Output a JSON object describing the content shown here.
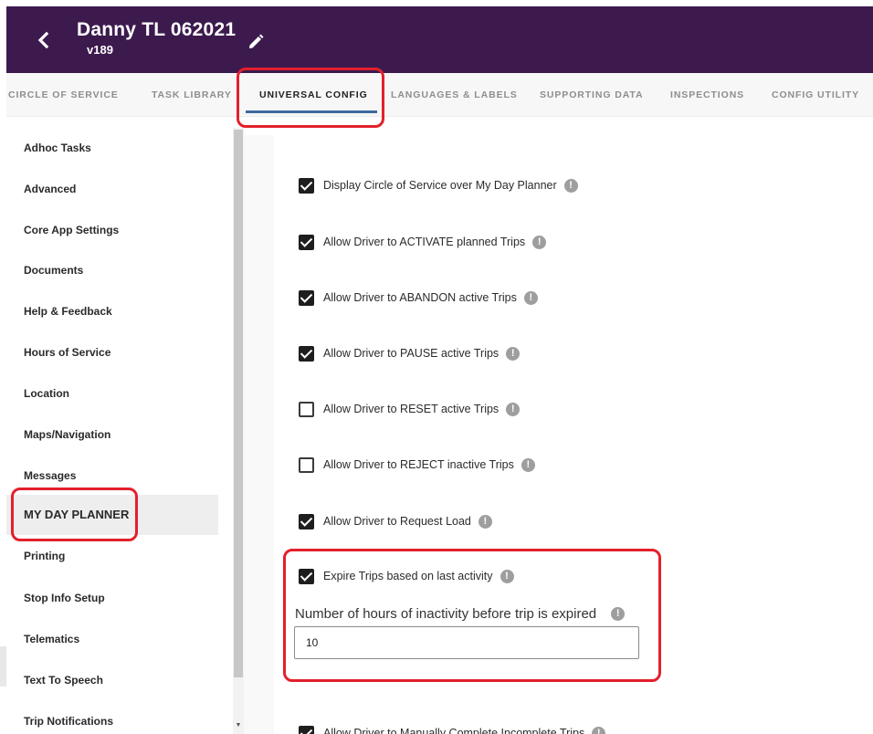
{
  "header": {
    "title": "Danny TL 062021",
    "version": "v189",
    "back_icon": "chevron-left-icon",
    "edit_icon": "pencil-icon",
    "background": "#3c1a4e"
  },
  "tabs": [
    {
      "label": "CIRCLE OF SERVICE"
    },
    {
      "label": "TASK LIBRARY"
    },
    {
      "label": "UNIVERSAL CONFIG",
      "active": true
    },
    {
      "label": "LANGUAGES & LABELS"
    },
    {
      "label": "SUPPORTING DATA"
    },
    {
      "label": "INSPECTIONS"
    },
    {
      "label": "CONFIG UTILITY"
    }
  ],
  "sidebar": {
    "items": [
      {
        "label": "Adhoc Tasks"
      },
      {
        "label": "Advanced"
      },
      {
        "label": "Core App Settings"
      },
      {
        "label": "Documents"
      },
      {
        "label": "Help & Feedback"
      },
      {
        "label": "Hours of Service"
      },
      {
        "label": "Location"
      },
      {
        "label": "Maps/Navigation"
      },
      {
        "label": "Messages"
      },
      {
        "label": "MY DAY PLANNER",
        "active": true
      },
      {
        "label": "Printing"
      },
      {
        "label": "Stop Info Setup"
      },
      {
        "label": "Telematics"
      },
      {
        "label": "Text To Speech"
      },
      {
        "label": "Trip Notifications"
      }
    ]
  },
  "options": [
    {
      "label": "Display Circle of Service over My Day Planner",
      "checked": true
    },
    {
      "label": "Allow Driver to ACTIVATE planned Trips",
      "checked": true
    },
    {
      "label": "Allow Driver to ABANDON active Trips",
      "checked": true
    },
    {
      "label": "Allow Driver to PAUSE active Trips",
      "checked": true
    },
    {
      "label": "Allow Driver to RESET active Trips",
      "checked": false
    },
    {
      "label": "Allow Driver to REJECT inactive Trips",
      "checked": false
    },
    {
      "label": "Allow Driver to Request Load",
      "checked": true
    },
    {
      "label": "Expire Trips based on last activity",
      "checked": true
    },
    {
      "label": "Allow Driver to Manually Complete Incomplete Trips",
      "checked": true
    }
  ],
  "expire_hours": {
    "label": "Number of hours of inactivity before trip is expired",
    "value": "10"
  },
  "info_glyph": "!",
  "colors": {
    "accent": "#3c6a9c",
    "annotation": "#e3202b"
  }
}
